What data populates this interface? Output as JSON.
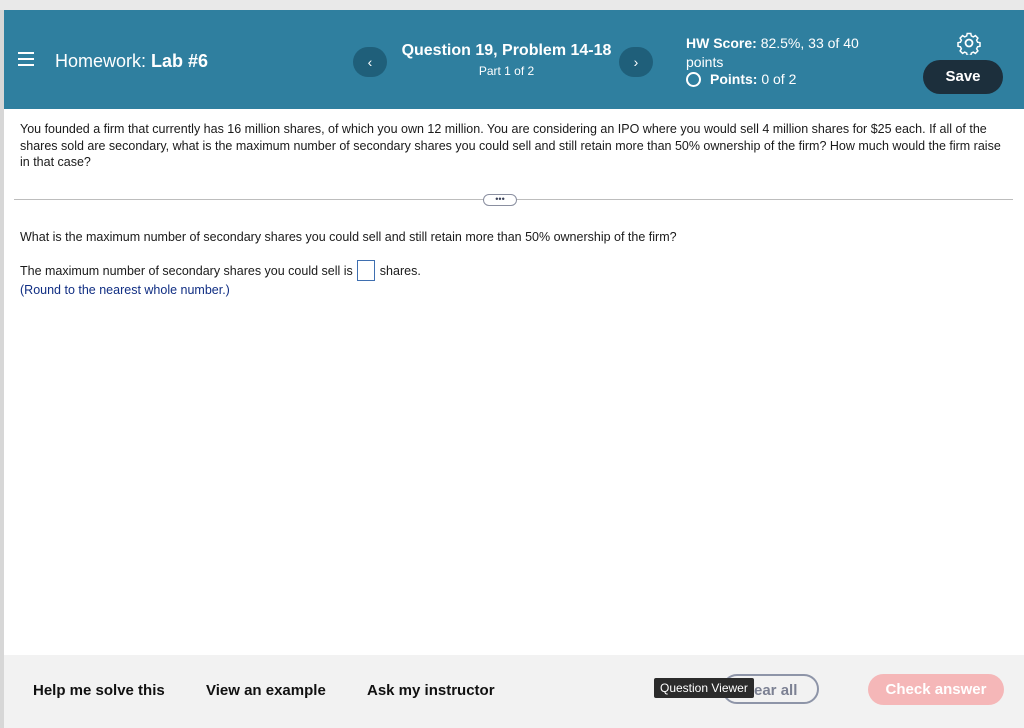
{
  "header": {
    "homework_prefix": "Homework:",
    "homework_name": "Lab #6",
    "question_title": "Question 19, Problem 14-18",
    "part": "Part 1 of 2",
    "prev_label": "‹",
    "next_label": "›",
    "hw_score_label": "HW Score:",
    "hw_score_value": "82.5%, 33 of 40",
    "hw_score_unit": "points",
    "points_label": "Points:",
    "points_value": "0 of 2",
    "save_label": "Save"
  },
  "problem": {
    "text": "You founded a firm that currently has 16 million shares, of which you own 12 million. You are considering an IPO where you would sell 4 million shares for $25 each. If all of the shares sold are secondary, what is the maximum number of secondary shares you could sell and still retain more than 50% ownership of the firm? How much would the firm raise in that case?",
    "more_label": "•••",
    "question": "What is the maximum number of secondary shares you could sell and still retain more than 50% ownership of the firm?",
    "answer_prefix": "The maximum number of secondary shares you could sell is",
    "answer_suffix": "shares.",
    "answer_value": "",
    "hint": "(Round to the nearest whole number.)"
  },
  "footer": {
    "help": "Help me solve this",
    "example": "View an example",
    "instructor": "Ask my instructor",
    "tooltip": "Question Viewer",
    "clear_label": "ear all",
    "check": "Check answer"
  },
  "colors": {
    "header": "#2f7f9f",
    "save": "#1c2f3c",
    "check": "#f5b7b8",
    "hint": "#102e83"
  },
  "icons": [
    "menu-icon",
    "chevron-left-icon",
    "chevron-right-icon",
    "gear-icon",
    "points-circle-icon"
  ]
}
